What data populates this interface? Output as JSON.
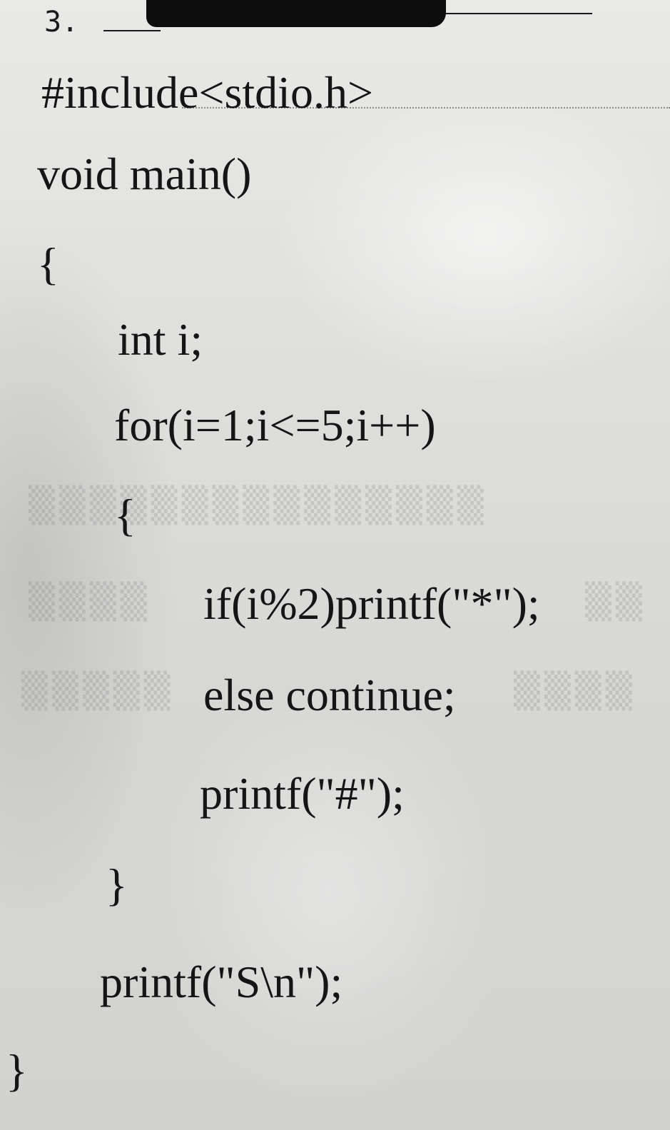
{
  "question_number": "3.",
  "code_lines": [
    "#include<stdio.h>",
    "void main()",
    "{",
    "int i;",
    "for(i=1;i<=5;i++)",
    "{",
    "if(i%2)printf(\"*\");",
    "else continue;",
    "printf(\"#\");",
    "}",
    "printf(\"S\\n\");",
    "}"
  ]
}
